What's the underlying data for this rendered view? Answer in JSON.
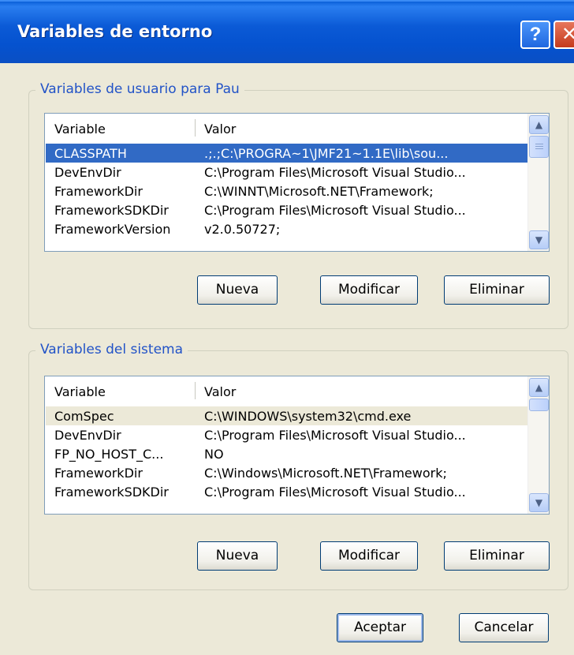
{
  "window": {
    "title": "Variables de entorno",
    "help_label": "?",
    "close_label": "✕"
  },
  "user_vars": {
    "legend": "Variables de usuario para Pau",
    "columns": [
      "Variable",
      "Valor"
    ],
    "rows": [
      {
        "name": "CLASSPATH",
        "value": ".;.;C:\\PROGRA~1\\JMF21~1.1E\\lib\\sou..."
      },
      {
        "name": "DevEnvDir",
        "value": "C:\\Program Files\\Microsoft Visual Studio..."
      },
      {
        "name": "FrameworkDir",
        "value": "C:\\WINNT\\Microsoft.NET\\Framework;"
      },
      {
        "name": "FrameworkSDKDir",
        "value": "C:\\Program Files\\Microsoft Visual Studio..."
      },
      {
        "name": "FrameworkVersion",
        "value": "v2.0.50727;"
      }
    ],
    "buttons": {
      "new": "Nueva",
      "edit": "Modificar",
      "delete": "Eliminar"
    }
  },
  "system_vars": {
    "legend": "Variables del sistema",
    "columns": [
      "Variable",
      "Valor"
    ],
    "rows": [
      {
        "name": "ComSpec",
        "value": "C:\\WINDOWS\\system32\\cmd.exe"
      },
      {
        "name": "DevEnvDir",
        "value": "C:\\Program Files\\Microsoft Visual Studio..."
      },
      {
        "name": "FP_NO_HOST_C...",
        "value": "NO"
      },
      {
        "name": "FrameworkDir",
        "value": "C:\\Windows\\Microsoft.NET\\Framework;"
      },
      {
        "name": "FrameworkSDKDir",
        "value": "C:\\Program Files\\Microsoft Visual Studio..."
      }
    ],
    "buttons": {
      "new": "Nueva",
      "edit": "Modificar",
      "delete": "Eliminar"
    }
  },
  "footer": {
    "ok_label": "Aceptar",
    "cancel_label": "Cancelar"
  },
  "colors": {
    "titlebar": "#0552cf",
    "selection": "#316ac5",
    "legend_text": "#2253c7",
    "dialog_bg": "#ece9d8"
  }
}
